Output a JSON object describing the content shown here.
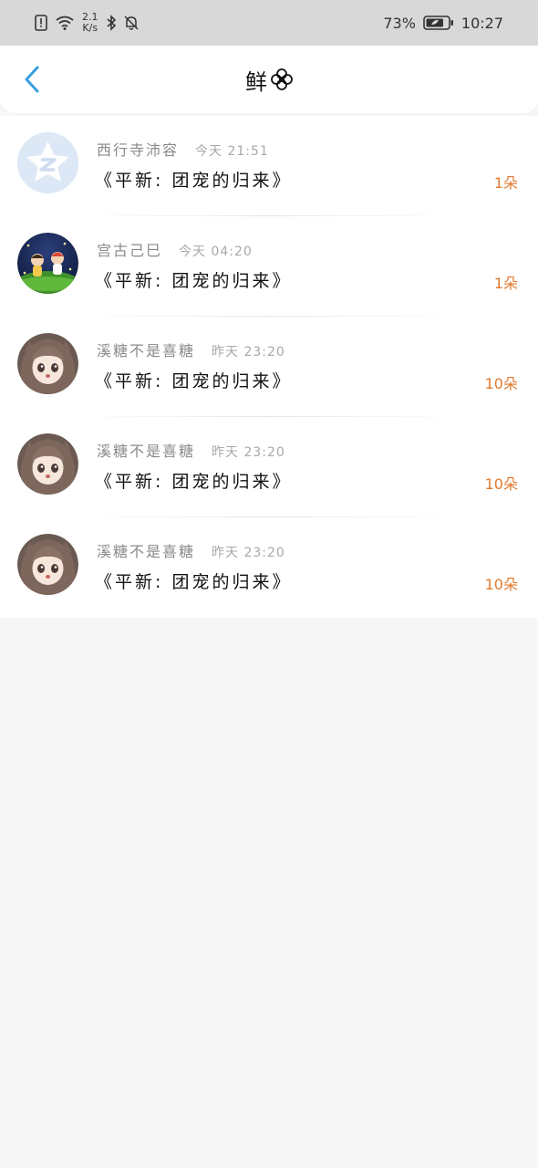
{
  "status_bar": {
    "net_speed_value": "2.1",
    "net_speed_unit": "K/s",
    "battery": "73%",
    "time": "10:27"
  },
  "nav": {
    "title": "鲜"
  },
  "list": [
    {
      "name": "西行寺沛容",
      "time": "今天 21:51",
      "title": "《平新: 团宠的归来》",
      "count": "1朵",
      "avatar": "qzone-avatar"
    },
    {
      "name": "宫古己巳",
      "time": "今天 04:20",
      "title": "《平新: 团宠的归来》",
      "count": "1朵",
      "avatar": "kids-avatar"
    },
    {
      "name": "溪糖不是喜糖",
      "time": "昨天 23:20",
      "title": "《平新: 团宠的归来》",
      "count": "10朵",
      "avatar": "anime-girl-avatar"
    },
    {
      "name": "溪糖不是喜糖",
      "time": "昨天 23:20",
      "title": "《平新: 团宠的归来》",
      "count": "10朵",
      "avatar": "anime-girl-avatar"
    },
    {
      "name": "溪糖不是喜糖",
      "time": "昨天 23:20",
      "title": "《平新: 团宠的归来》",
      "count": "10朵",
      "avatar": "anime-girl-avatar"
    }
  ],
  "colors": {
    "accent_blue": "#3a9ee0",
    "count_orange": "#e07a2e"
  }
}
